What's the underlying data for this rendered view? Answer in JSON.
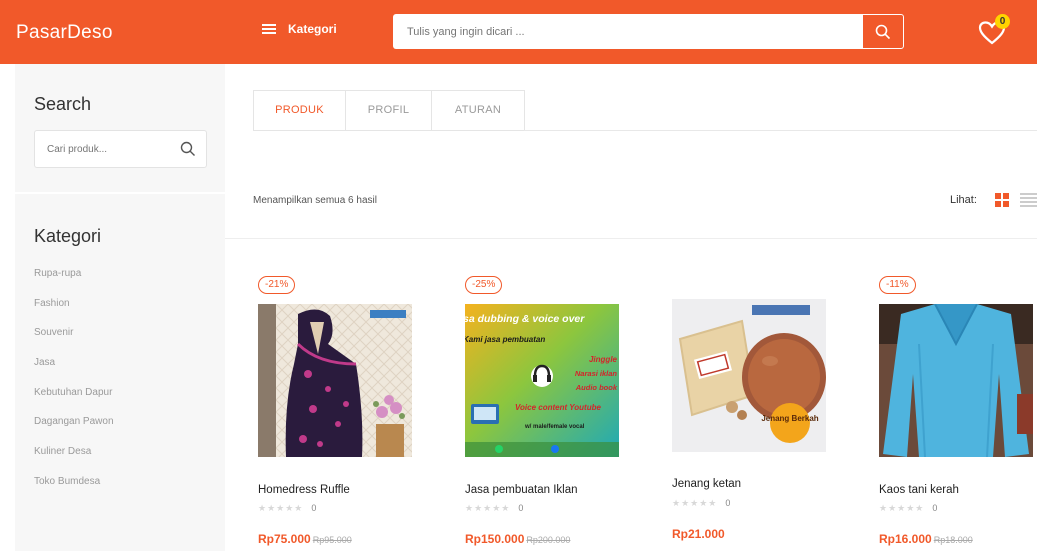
{
  "brand": {
    "logo_text": "PasarDeso",
    "accent": "#f1592a"
  },
  "header": {
    "category_label": "Kategori",
    "search_placeholder": "Tulis yang ingin dicari ...",
    "wishlist_count": "0"
  },
  "sidebar": {
    "search_title": "Search",
    "search_placeholder": "Cari produk...",
    "category_title": "Kategori",
    "categories": [
      "Rupa-rupa",
      "Fashion",
      "Souvenir",
      "Jasa",
      "Kebutuhan Dapur",
      "Dagangan Pawon",
      "Kuliner Desa",
      "Toko Bumdesa"
    ]
  },
  "tabs": [
    "PRODUK",
    "PROFIL",
    "ATURAN"
  ],
  "result_text": "Menampilkan semua 6 hasil",
  "view_label": "Lihat:",
  "products": [
    {
      "name": "Homedress Ruffle",
      "badge": "-21%",
      "rating_count": "0",
      "price": "Rp75.000",
      "old_price": "Rp95.000"
    },
    {
      "name": "Jasa pembuatan Iklan",
      "badge": "-25%",
      "rating_count": "0",
      "price": "Rp150.000",
      "old_price": "Rp200.000",
      "image_text": {
        "l1": "sa dubbing & voice over",
        "l2": "Kami jasa pembuatan",
        "l3": "Jinggle",
        "l4": "Narasi iklan",
        "l5": "Audio book",
        "l6": "Voice content Youtube",
        "l7": "w/ male/female vocal"
      }
    },
    {
      "name": "Jenang ketan",
      "badge": "",
      "rating_count": "0",
      "price": "Rp21.000",
      "old_price": "",
      "image_text": {
        "sticker": "Jenang Berkah"
      }
    },
    {
      "name": "Kaos tani kerah",
      "badge": "-11%",
      "rating_count": "0",
      "price": "Rp16.000",
      "old_price": "Rp18.000"
    }
  ]
}
